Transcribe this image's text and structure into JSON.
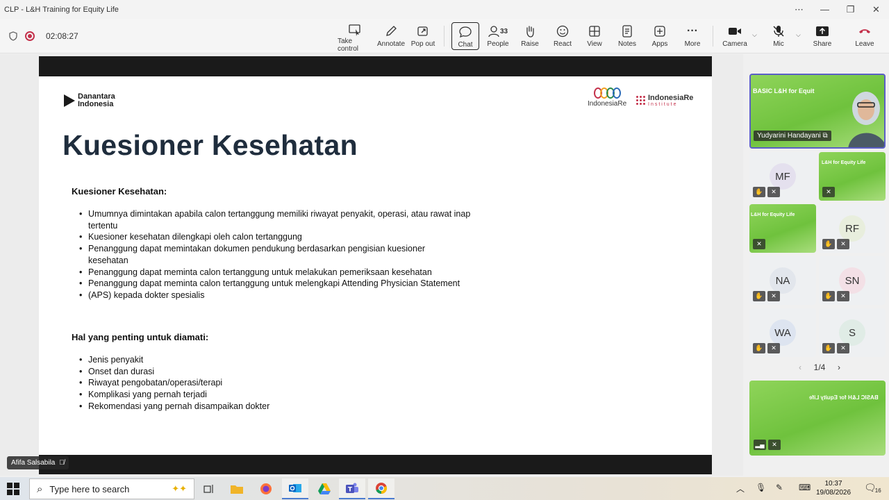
{
  "window": {
    "title": "CLP - L&H Training for Equity Life"
  },
  "toolbar": {
    "timer": "02:08:27",
    "buttons": [
      {
        "label": "Take control",
        "icon": "take-control-icon"
      },
      {
        "label": "Annotate",
        "icon": "pen-icon"
      },
      {
        "label": "Pop out",
        "icon": "pop-out-icon"
      },
      {
        "label": "Chat",
        "icon": "chat-icon"
      },
      {
        "label": "People",
        "icon": "people-icon",
        "count": "33"
      },
      {
        "label": "Raise",
        "icon": "hand-icon"
      },
      {
        "label": "React",
        "icon": "smiley-icon"
      },
      {
        "label": "View",
        "icon": "grid-icon"
      },
      {
        "label": "Notes",
        "icon": "notes-icon"
      },
      {
        "label": "Apps",
        "icon": "plus-square-icon"
      },
      {
        "label": "More",
        "icon": "ellipsis-icon"
      },
      {
        "label": "Camera",
        "icon": "camera-icon"
      },
      {
        "label": "Mic",
        "icon": "mic-off-icon"
      },
      {
        "label": "Share",
        "icon": "share-icon"
      },
      {
        "label": "Leave",
        "icon": "phone-hangup-icon"
      }
    ]
  },
  "slide": {
    "logo_left": [
      "Danantara",
      "Indonesia"
    ],
    "logo_mid": "IndonesiaRe",
    "logo_right": "IndonesiaRe",
    "logo_right_sub": "Institute",
    "title": "Kuesioner Kesehatan",
    "section1": {
      "heading": "Kuesioner Kesehatan:",
      "bullets": [
        "Umumnya dimintakan apabila calon tertanggung memiliki riwayat penyakit, operasi, atau rawat inap  tertentu",
        "Kuesioner kesehatan dilengkapi oleh calon tertanggung",
        "Penanggung dapat memintakan dokumen pendukung berdasarkan pengisian kuesioner kesehatan",
        "Penanggung dapat meminta calon tertanggung untuk melakukan pemeriksaan kesehatan",
        "Penanggung dapat meminta calon tertanggung untuk melengkapi Attending Physician Statement",
        "(APS) kepada dokter spesialis"
      ]
    },
    "section2": {
      "heading": "Hal yang penting untuk diamati:",
      "bullets": [
        "Jenis penyakit",
        "Onset dan durasi",
        "Riwayat pengobatan/operasi/terapi",
        "Komplikasi yang pernah terjadi",
        "Rekomendasi yang pernah disampaikan dokter"
      ]
    }
  },
  "presenter": {
    "name": "Afifa Salsabila"
  },
  "participants": {
    "featured": {
      "name": "Yudyarini Handayani",
      "banner": "BASIC L&H for Equit"
    },
    "tiles": [
      {
        "initials": "MF",
        "type": "avatar",
        "color": "#e4e0ee"
      },
      {
        "initials": "",
        "type": "video",
        "banner": "L&H for Equity Life"
      },
      {
        "initials": "",
        "type": "video",
        "banner": "L&H for Equity Life"
      },
      {
        "initials": "RF",
        "type": "avatar",
        "color": "#e8eedd"
      },
      {
        "initials": "NA",
        "type": "avatar",
        "color": "#e2e6ec"
      },
      {
        "initials": "SN",
        "type": "avatar",
        "color": "#f3e0e6"
      },
      {
        "initials": "WA",
        "type": "avatar",
        "color": "#dde4f0"
      },
      {
        "initials": "S",
        "type": "avatar",
        "color": "#e0ece6"
      }
    ],
    "page": "1/4",
    "self_view_banner": "BASIC L&H for Equity Life"
  },
  "taskbar": {
    "search_placeholder": "Type here to search",
    "time": "10:37",
    "date": "19/08/2026",
    "notifications": "16"
  }
}
